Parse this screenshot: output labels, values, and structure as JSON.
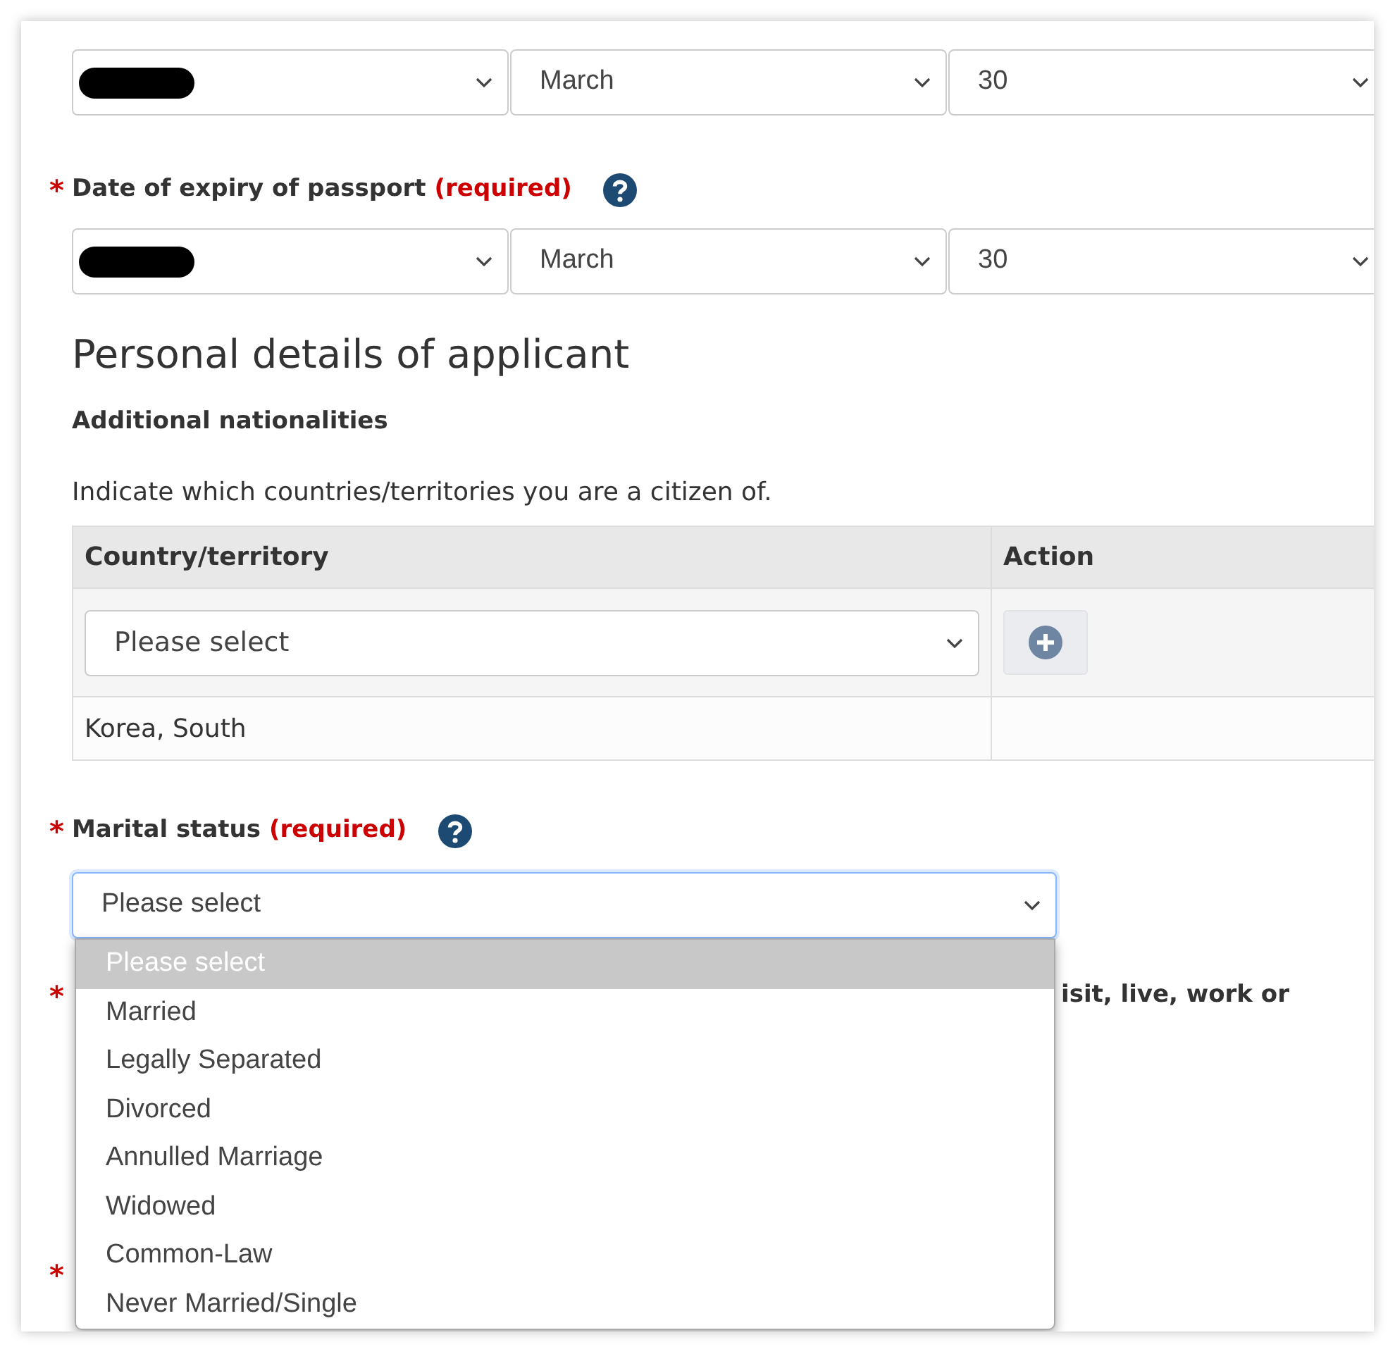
{
  "issue_date": {
    "selects": [
      {
        "kind": "redacted"
      },
      {
        "kind": "text",
        "value": "March"
      },
      {
        "kind": "text",
        "value": "30"
      }
    ]
  },
  "expiry_date": {
    "required_mark": "*",
    "label": "Date of expiry of passport",
    "required_text": "(required)",
    "selects": [
      {
        "kind": "redacted"
      },
      {
        "kind": "text",
        "value": "March"
      },
      {
        "kind": "text",
        "value": "30"
      }
    ]
  },
  "section_title": "Personal details of applicant",
  "nationalities": {
    "heading": "Additional nationalities",
    "hint": "Indicate which countries/territories you are a citizen of.",
    "columns": [
      "Country/territory",
      "Action"
    ],
    "rows": [
      {
        "kind": "select",
        "country": "Please select"
      },
      {
        "kind": "text",
        "country": "Korea, South"
      }
    ]
  },
  "marital_status": {
    "required_mark": "*",
    "label": "Marital status",
    "required_text": "(required)",
    "value": "Please select",
    "focused": true,
    "options": [
      {
        "label": "Please select",
        "selected": true
      },
      {
        "label": "Married",
        "selected": false
      },
      {
        "label": "Legally Separated",
        "selected": false
      },
      {
        "label": "Divorced",
        "selected": false
      },
      {
        "label": "Annulled Marriage",
        "selected": false
      },
      {
        "label": "Widowed",
        "selected": false
      },
      {
        "label": "Common-Law",
        "selected": false
      },
      {
        "label": "Never Married/Single",
        "selected": false
      }
    ]
  },
  "next_question": {
    "required_mark": "*",
    "visible_text": "isit, live, work or"
  },
  "employment_question": {
    "required_mark": "*"
  }
}
